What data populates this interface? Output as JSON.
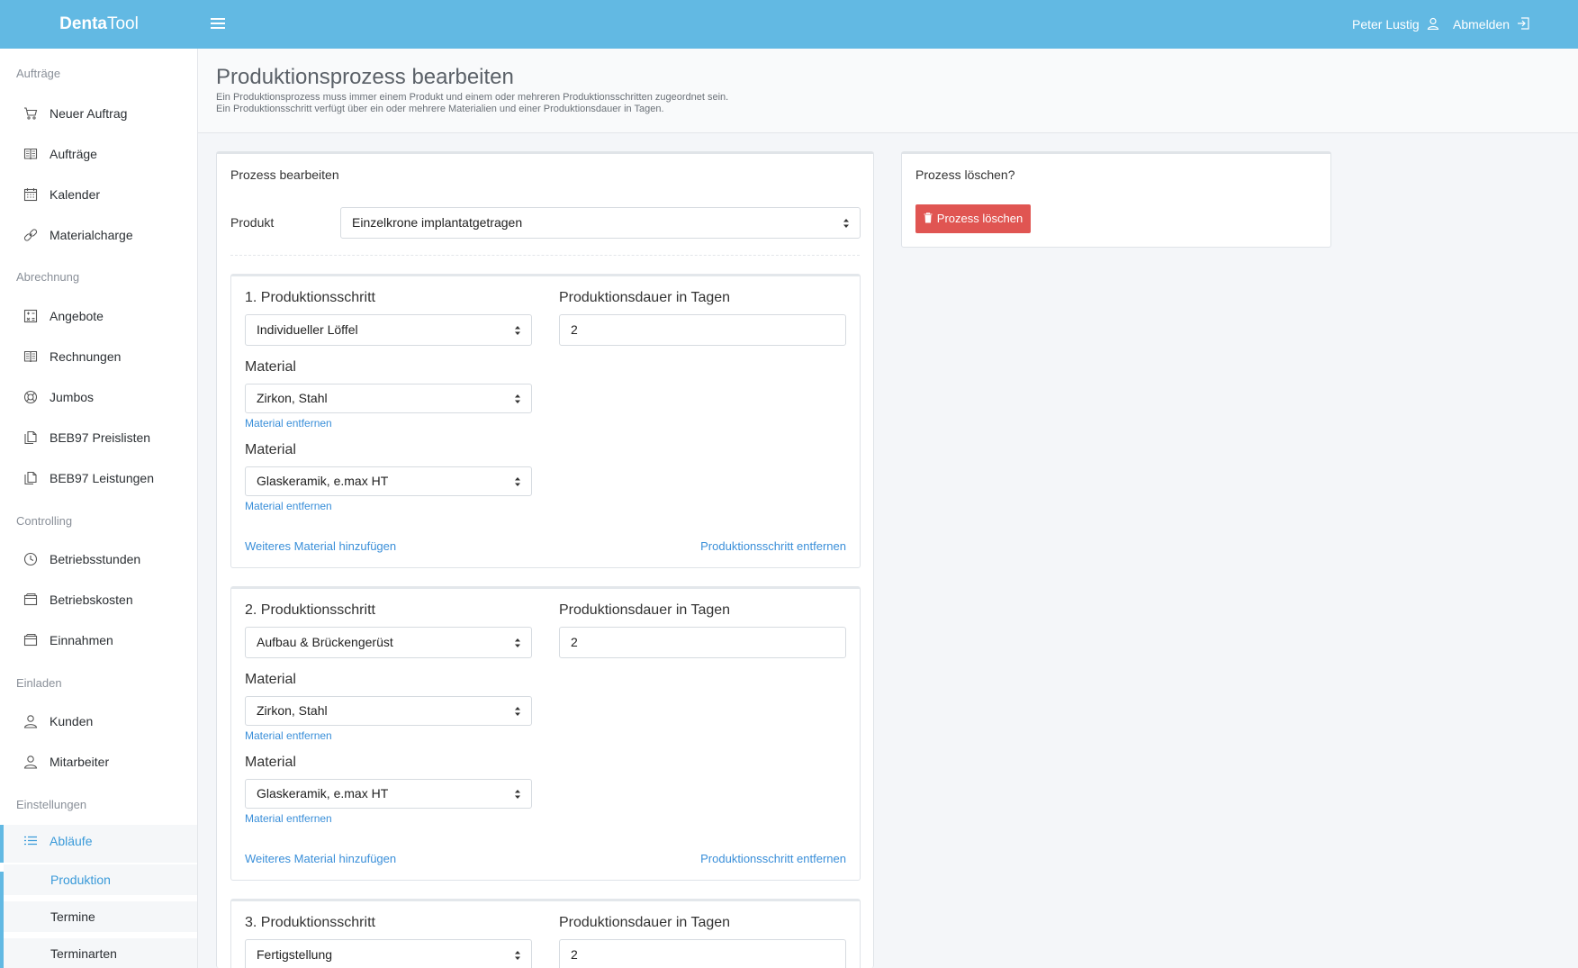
{
  "brand": {
    "part1": "Denta",
    "part2": "Tool"
  },
  "topbar": {
    "user": "Peter Lustig",
    "logout": "Abmelden"
  },
  "sidebar": {
    "sections": {
      "auftraege": "Aufträge",
      "abrechnung": "Abrechnung",
      "controlling": "Controlling",
      "einladen": "Einladen",
      "einstellungen": "Einstellungen"
    },
    "items": {
      "neuer_auftrag": "Neuer Auftrag",
      "auftraege": "Aufträge",
      "kalender": "Kalender",
      "materialcharge": "Materialcharge",
      "angebote": "Angebote",
      "rechnungen": "Rechnungen",
      "jumbos": "Jumbos",
      "beb97_preislisten": "BEB97 Preislisten",
      "beb97_leistungen": "BEB97 Leistungen",
      "betriebsstunden": "Betriebsstunden",
      "betriebskosten": "Betriebskosten",
      "einnahmen": "Einnahmen",
      "kunden": "Kunden",
      "mitarbeiter": "Mitarbeiter",
      "ablaeufe": "Abläufe"
    },
    "subitems": {
      "produktion": "Produktion",
      "termine": "Termine",
      "terminarten": "Terminarten"
    }
  },
  "page": {
    "title": "Produktionsprozess bearbeiten",
    "desc_line1": "Ein Produktionsprozess muss immer einem Produkt und einem oder mehreren Produktionsschritten zugeordnet sein.",
    "desc_line2": "Ein Produktionsschritt verfügt über ein oder mehrere Materialien und einer Produktionsdauer in Tagen."
  },
  "edit_card": {
    "title": "Prozess bearbeiten",
    "product_label": "Produkt",
    "product_value": "Einzelkrone implantatgetragen"
  },
  "steps": [
    {
      "heading": "1. Produktionsschritt",
      "step_value": "Individueller Löffel",
      "duration_label": "Produktionsdauer in Tagen",
      "duration_value": "2",
      "materials": [
        {
          "label": "Material",
          "value": "Zirkon, Stahl",
          "remove": "Material entfernen"
        },
        {
          "label": "Material",
          "value": "Glaskeramik, e.max HT",
          "remove": "Material entfernen"
        }
      ],
      "add_material": "Weiteres Material hinzufügen",
      "remove_step": "Produktionsschritt entfernen"
    },
    {
      "heading": "2. Produktionsschritt",
      "step_value": "Aufbau & Brückengerüst",
      "duration_label": "Produktionsdauer in Tagen",
      "duration_value": "2",
      "materials": [
        {
          "label": "Material",
          "value": "Zirkon, Stahl",
          "remove": "Material entfernen"
        },
        {
          "label": "Material",
          "value": "Glaskeramik, e.max HT",
          "remove": "Material entfernen"
        }
      ],
      "add_material": "Weiteres Material hinzufügen",
      "remove_step": "Produktionsschritt entfernen"
    },
    {
      "heading": "3. Produktionsschritt",
      "step_value": "Fertigstellung",
      "duration_label": "Produktionsdauer in Tagen",
      "duration_value": "2"
    }
  ],
  "delete_card": {
    "title": "Prozess löschen?",
    "button": "Prozess löschen"
  },
  "colors": {
    "topbar": "#62b9e3",
    "link": "#3a8fd9",
    "danger": "#e05552",
    "active": "#3a9ad9"
  }
}
